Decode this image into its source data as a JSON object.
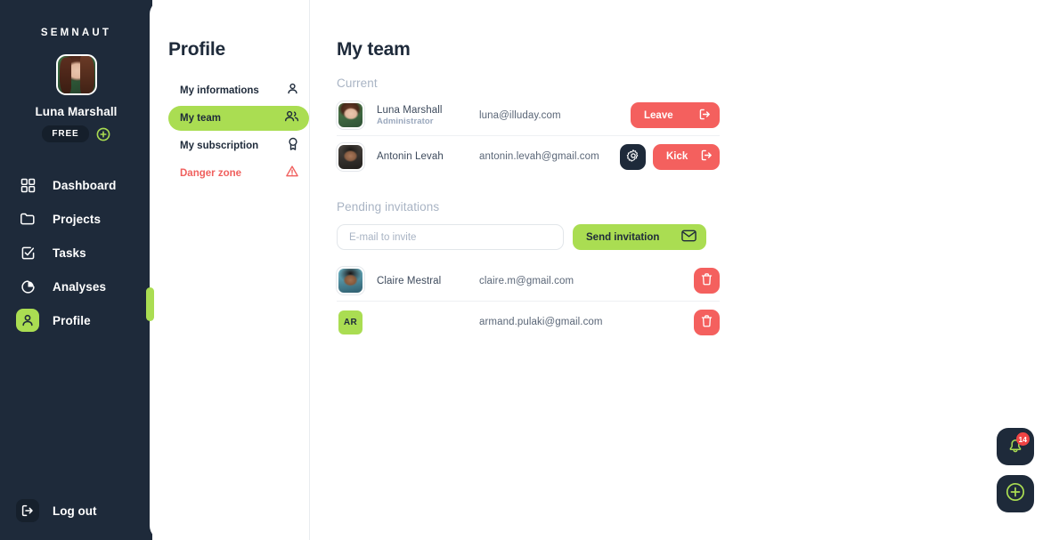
{
  "brand": {
    "name": "SEMNAUT"
  },
  "user": {
    "name": "Luna Marshall",
    "plan": "FREE",
    "upgrade_icon": "plus-circle-icon",
    "avatar_icon": "user-avatar"
  },
  "sidebar": {
    "items": [
      {
        "label": "Dashboard",
        "icon": "grid-icon",
        "active": false
      },
      {
        "label": "Projects",
        "icon": "folder-icon",
        "active": false
      },
      {
        "label": "Tasks",
        "icon": "checkbox-icon",
        "active": false
      },
      {
        "label": "Analyses",
        "icon": "pie-chart-icon",
        "active": false
      },
      {
        "label": "Profile",
        "icon": "user-icon",
        "active": true
      }
    ],
    "logout": {
      "label": "Log out",
      "icon": "logout-icon"
    }
  },
  "subnav": {
    "title": "Profile",
    "items": [
      {
        "label": "My informations",
        "icon": "user-icon",
        "active": false,
        "danger": false
      },
      {
        "label": "My team",
        "icon": "users-icon",
        "active": true,
        "danger": false
      },
      {
        "label": "My subscription",
        "icon": "award-icon",
        "active": false,
        "danger": false
      },
      {
        "label": "Danger zone",
        "icon": "warning-triangle-icon",
        "active": false,
        "danger": true
      }
    ]
  },
  "main": {
    "title": "My team",
    "current_label": "Current",
    "current_members": [
      {
        "name": "Luna Marshall",
        "role": "Administrator",
        "email": "luna@illuday.com",
        "avatar_kind": "photo",
        "avatar_class": "av-luna",
        "initials": "",
        "actions": [
          {
            "kind": "danger",
            "label": "Leave",
            "icon": "logout-icon",
            "name": "leave-button"
          }
        ]
      },
      {
        "name": "Antonin Levah",
        "role": "",
        "email": "antonin.levah@gmail.com",
        "avatar_kind": "photo",
        "avatar_class": "av-anto",
        "initials": "",
        "actions": [
          {
            "kind": "gear",
            "label": "",
            "icon": "gear-icon",
            "name": "member-settings-button"
          },
          {
            "kind": "danger",
            "label": "Kick",
            "icon": "logout-icon",
            "name": "kick-button"
          }
        ]
      }
    ],
    "pending_label": "Pending invitations",
    "invite": {
      "placeholder": "E-mail to invite",
      "value": "",
      "send_label": "Send invitation",
      "send_icon": "envelope-icon"
    },
    "pending_invitations": [
      {
        "name": "Claire Mestral",
        "email": "claire.m@gmail.com",
        "avatar_kind": "photo",
        "avatar_class": "av-claire",
        "initials": "",
        "delete_icon": "trash-icon"
      },
      {
        "name": "",
        "email": "armand.pulaki@gmail.com",
        "avatar_kind": "initials",
        "avatar_class": "",
        "initials": "AR",
        "delete_icon": "trash-icon"
      }
    ]
  },
  "floating": {
    "notifications": {
      "icon": "bell-icon",
      "badge": "14"
    },
    "add": {
      "icon": "plus-circle-icon"
    }
  },
  "colors": {
    "accent_green": "#aadd52",
    "dark_navy": "#1e2a3a",
    "danger_red": "#f4605e",
    "badge_red": "#ef4444",
    "muted_text": "#a9b4c4"
  }
}
